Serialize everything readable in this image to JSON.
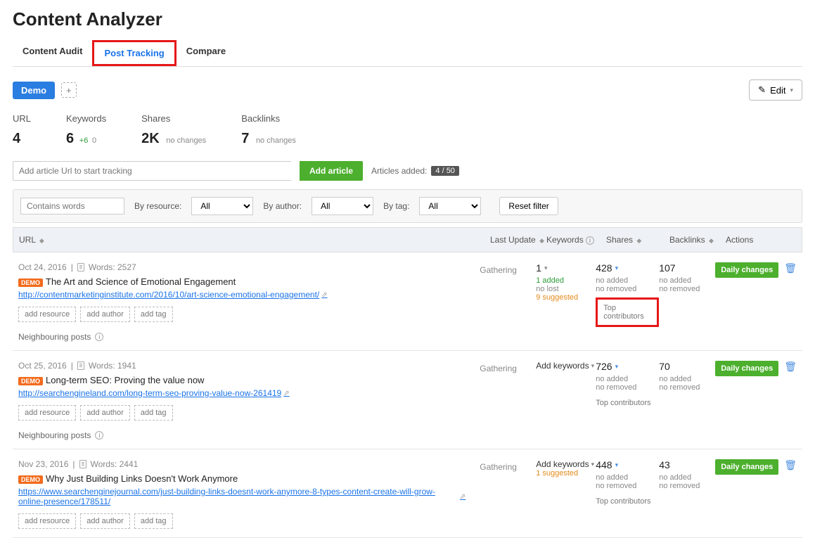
{
  "page_title": "Content Analyzer",
  "tabs": [
    "Content Audit",
    "Post Tracking",
    "Compare"
  ],
  "active_tab": 1,
  "demo_pill": "Demo",
  "edit_label": "Edit",
  "summary": {
    "url": {
      "label": "URL",
      "value": "4"
    },
    "keywords": {
      "label": "Keywords",
      "value": "6",
      "delta": "+6",
      "delta2": "0"
    },
    "shares": {
      "label": "Shares",
      "value": "2K",
      "note": "no changes"
    },
    "backlinks": {
      "label": "Backlinks",
      "value": "7",
      "note": "no changes"
    }
  },
  "url_input_placeholder": "Add article Url to start tracking",
  "add_article_label": "Add article",
  "articles_added_label": "Articles added:",
  "articles_added_count": "4 / 50",
  "filters": {
    "contains": "Contains words",
    "by_resource": "By resource:",
    "by_author": "By author:",
    "by_tag": "By tag:",
    "all": "All",
    "reset": "Reset filter"
  },
  "th": {
    "url": "URL",
    "last": "Last Update",
    "kw": "Keywords",
    "sh": "Shares",
    "bl": "Backlinks",
    "act": "Actions"
  },
  "rows": [
    {
      "date": "Oct 24, 2016",
      "words_label": "Words:",
      "words": "2527",
      "title": "The Art and Science of Emotional Engagement",
      "url": "http://contentmarketinginstitute.com/2016/10/art-science-emotional-engagement/",
      "last": "Gathering",
      "kw_value": "1",
      "kw_lines": [
        "1 added",
        "no lost",
        "9 suggested"
      ],
      "kw_colors": [
        "green",
        "grey",
        "orange"
      ],
      "sh_value": "428",
      "sh_lines": [
        "no added",
        "no removed"
      ],
      "bl_value": "107",
      "bl_lines": [
        "no added",
        "no removed"
      ],
      "top_contrib_boxed": true,
      "add_kw_mode": false
    },
    {
      "date": "Oct 25, 2016",
      "words_label": "Words:",
      "words": "1941",
      "title": "Long-term SEO: Proving the value now",
      "url": "http://searchengineland.com/long-term-seo-proving-value-now-261419",
      "last": "Gathering",
      "add_kw_mode": true,
      "kw_lines": [],
      "sh_value": "726",
      "sh_lines": [
        "no added",
        "no removed"
      ],
      "bl_value": "70",
      "bl_lines": [
        "no added",
        "no removed"
      ],
      "top_contrib_boxed": false
    },
    {
      "date": "Nov 23, 2016",
      "words_label": "Words:",
      "words": "2441",
      "title": "Why Just Building Links Doesn't Work Anymore",
      "url": "https://www.searchenginejournal.com/just-building-links-doesnt-work-anymore-8-types-content-create-will-grow-online-presence/178511/",
      "last": "Gathering",
      "add_kw_mode": true,
      "kw_lines": [
        "1 suggested"
      ],
      "kw_colors": [
        "orange"
      ],
      "sh_value": "448",
      "sh_lines": [
        "no added",
        "no removed"
      ],
      "bl_value": "43",
      "bl_lines": [
        "no added",
        "no removed"
      ],
      "top_contrib_boxed": false
    }
  ],
  "labels": {
    "add_resource": "add resource",
    "add_author": "add author",
    "add_tag": "add tag",
    "neighbouring": "Neighbouring posts",
    "add_keywords": "Add keywords",
    "top_contrib": "Top contributors",
    "daily_changes": "Daily changes",
    "demo_badge": "Demo"
  }
}
